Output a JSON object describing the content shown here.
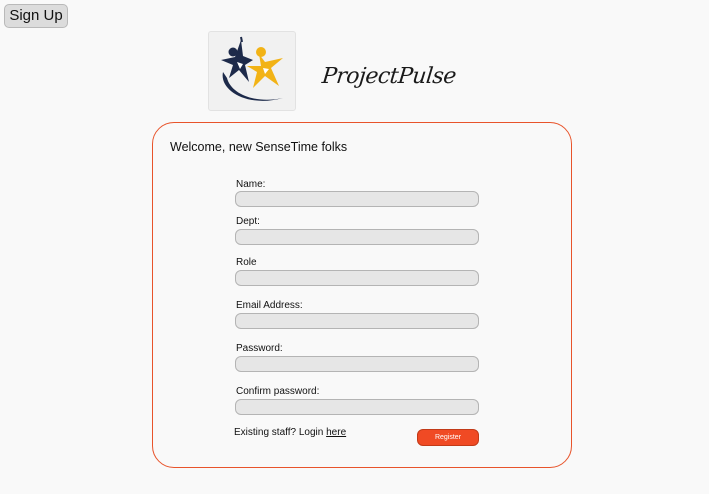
{
  "header": {
    "signup_label": "Sign Up"
  },
  "brand": {
    "name": "ProjectPulse",
    "logo_icon": "star-people-logo-icon"
  },
  "form": {
    "welcome": "Welcome, new SenseTime folks",
    "fields": [
      {
        "label": "Name:",
        "value": ""
      },
      {
        "label": "Dept:",
        "value": ""
      },
      {
        "label": "Role",
        "value": ""
      },
      {
        "label": "Email Address:",
        "value": ""
      },
      {
        "label": "Password:",
        "value": ""
      },
      {
        "label": "Confirm password:",
        "value": ""
      }
    ],
    "existing_text": "Existing staff? Login",
    "login_link": "here",
    "register_label": "Register"
  },
  "colors": {
    "accent": "#e8542b",
    "register_bg": "#f04a24",
    "logo_navy": "#1d2a4a",
    "logo_gold": "#f2b316"
  }
}
